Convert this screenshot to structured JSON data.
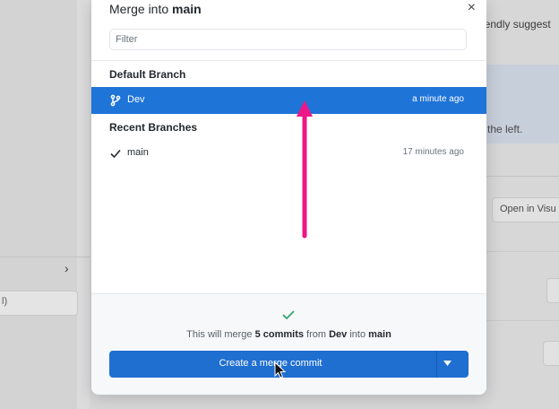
{
  "background": {
    "right_text": "iendly suggest",
    "right_text2": "the left.",
    "right_button": "Open in Visu",
    "left_field": "l)"
  },
  "modal": {
    "title_prefix": "Merge into ",
    "title_branch": "main",
    "close_label": "×",
    "filter_placeholder": "Filter",
    "default_section": "Default Branch",
    "recent_section": "Recent Branches",
    "default_branches": [
      {
        "name": "Dev",
        "time": "a minute ago",
        "icon": "branch-icon",
        "selected": true
      }
    ],
    "recent_branches": [
      {
        "name": "main",
        "time": "17 minutes ago",
        "icon": "check-icon",
        "selected": false
      }
    ]
  },
  "footer": {
    "summary_pre": "This will merge ",
    "summary_count": "5 commits",
    "summary_mid1": " from ",
    "summary_from": "Dev",
    "summary_mid2": " into ",
    "summary_into": "main",
    "button_label": "Create a merge commit"
  },
  "colors": {
    "accent": "#1f74d8",
    "annotation": "#ee1787",
    "success": "#34a36d"
  }
}
